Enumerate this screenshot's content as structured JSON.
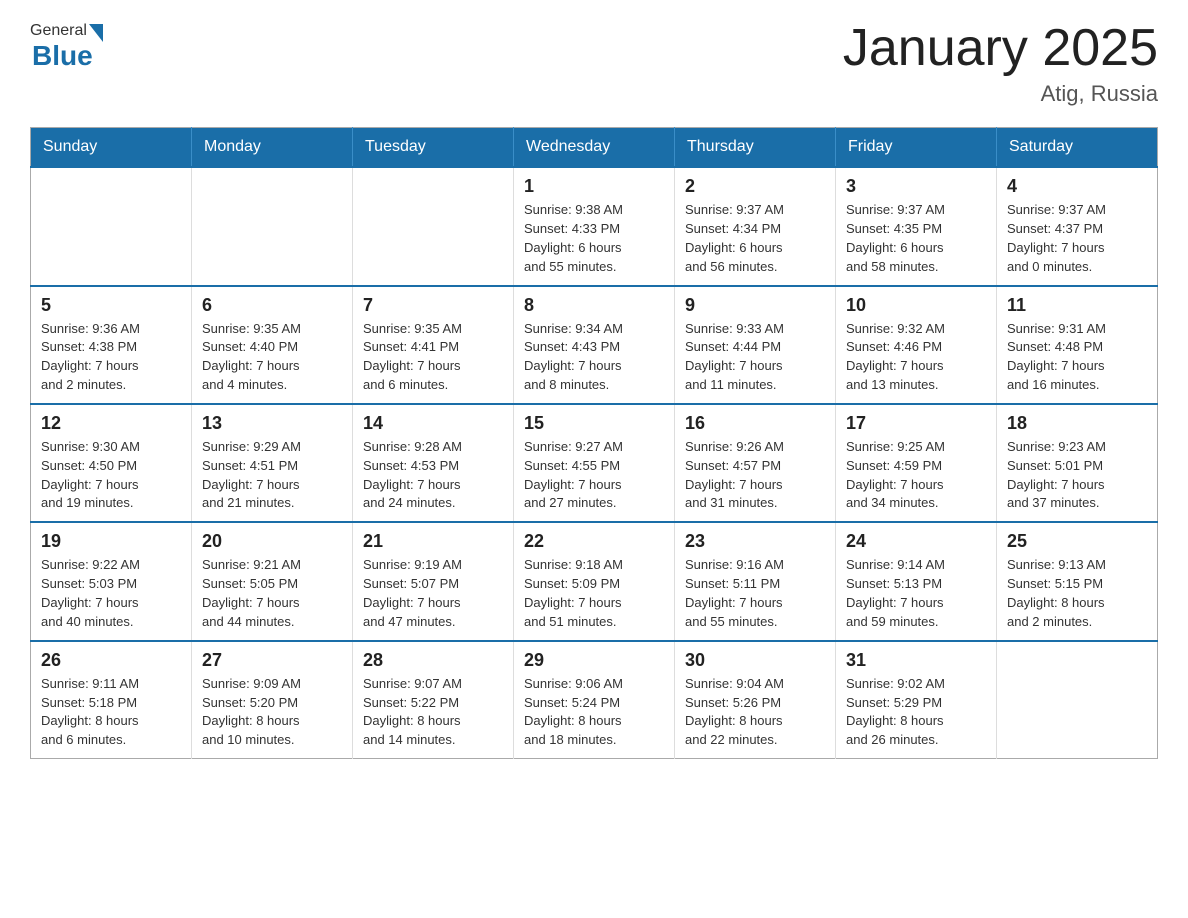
{
  "header": {
    "logo": {
      "part1": "General",
      "part2": "Blue"
    },
    "title": "January 2025",
    "subtitle": "Atig, Russia"
  },
  "weekdays": [
    "Sunday",
    "Monday",
    "Tuesday",
    "Wednesday",
    "Thursday",
    "Friday",
    "Saturday"
  ],
  "weeks": [
    [
      {
        "day": "",
        "info": ""
      },
      {
        "day": "",
        "info": ""
      },
      {
        "day": "",
        "info": ""
      },
      {
        "day": "1",
        "info": "Sunrise: 9:38 AM\nSunset: 4:33 PM\nDaylight: 6 hours\nand 55 minutes."
      },
      {
        "day": "2",
        "info": "Sunrise: 9:37 AM\nSunset: 4:34 PM\nDaylight: 6 hours\nand 56 minutes."
      },
      {
        "day": "3",
        "info": "Sunrise: 9:37 AM\nSunset: 4:35 PM\nDaylight: 6 hours\nand 58 minutes."
      },
      {
        "day": "4",
        "info": "Sunrise: 9:37 AM\nSunset: 4:37 PM\nDaylight: 7 hours\nand 0 minutes."
      }
    ],
    [
      {
        "day": "5",
        "info": "Sunrise: 9:36 AM\nSunset: 4:38 PM\nDaylight: 7 hours\nand 2 minutes."
      },
      {
        "day": "6",
        "info": "Sunrise: 9:35 AM\nSunset: 4:40 PM\nDaylight: 7 hours\nand 4 minutes."
      },
      {
        "day": "7",
        "info": "Sunrise: 9:35 AM\nSunset: 4:41 PM\nDaylight: 7 hours\nand 6 minutes."
      },
      {
        "day": "8",
        "info": "Sunrise: 9:34 AM\nSunset: 4:43 PM\nDaylight: 7 hours\nand 8 minutes."
      },
      {
        "day": "9",
        "info": "Sunrise: 9:33 AM\nSunset: 4:44 PM\nDaylight: 7 hours\nand 11 minutes."
      },
      {
        "day": "10",
        "info": "Sunrise: 9:32 AM\nSunset: 4:46 PM\nDaylight: 7 hours\nand 13 minutes."
      },
      {
        "day": "11",
        "info": "Sunrise: 9:31 AM\nSunset: 4:48 PM\nDaylight: 7 hours\nand 16 minutes."
      }
    ],
    [
      {
        "day": "12",
        "info": "Sunrise: 9:30 AM\nSunset: 4:50 PM\nDaylight: 7 hours\nand 19 minutes."
      },
      {
        "day": "13",
        "info": "Sunrise: 9:29 AM\nSunset: 4:51 PM\nDaylight: 7 hours\nand 21 minutes."
      },
      {
        "day": "14",
        "info": "Sunrise: 9:28 AM\nSunset: 4:53 PM\nDaylight: 7 hours\nand 24 minutes."
      },
      {
        "day": "15",
        "info": "Sunrise: 9:27 AM\nSunset: 4:55 PM\nDaylight: 7 hours\nand 27 minutes."
      },
      {
        "day": "16",
        "info": "Sunrise: 9:26 AM\nSunset: 4:57 PM\nDaylight: 7 hours\nand 31 minutes."
      },
      {
        "day": "17",
        "info": "Sunrise: 9:25 AM\nSunset: 4:59 PM\nDaylight: 7 hours\nand 34 minutes."
      },
      {
        "day": "18",
        "info": "Sunrise: 9:23 AM\nSunset: 5:01 PM\nDaylight: 7 hours\nand 37 minutes."
      }
    ],
    [
      {
        "day": "19",
        "info": "Sunrise: 9:22 AM\nSunset: 5:03 PM\nDaylight: 7 hours\nand 40 minutes."
      },
      {
        "day": "20",
        "info": "Sunrise: 9:21 AM\nSunset: 5:05 PM\nDaylight: 7 hours\nand 44 minutes."
      },
      {
        "day": "21",
        "info": "Sunrise: 9:19 AM\nSunset: 5:07 PM\nDaylight: 7 hours\nand 47 minutes."
      },
      {
        "day": "22",
        "info": "Sunrise: 9:18 AM\nSunset: 5:09 PM\nDaylight: 7 hours\nand 51 minutes."
      },
      {
        "day": "23",
        "info": "Sunrise: 9:16 AM\nSunset: 5:11 PM\nDaylight: 7 hours\nand 55 minutes."
      },
      {
        "day": "24",
        "info": "Sunrise: 9:14 AM\nSunset: 5:13 PM\nDaylight: 7 hours\nand 59 minutes."
      },
      {
        "day": "25",
        "info": "Sunrise: 9:13 AM\nSunset: 5:15 PM\nDaylight: 8 hours\nand 2 minutes."
      }
    ],
    [
      {
        "day": "26",
        "info": "Sunrise: 9:11 AM\nSunset: 5:18 PM\nDaylight: 8 hours\nand 6 minutes."
      },
      {
        "day": "27",
        "info": "Sunrise: 9:09 AM\nSunset: 5:20 PM\nDaylight: 8 hours\nand 10 minutes."
      },
      {
        "day": "28",
        "info": "Sunrise: 9:07 AM\nSunset: 5:22 PM\nDaylight: 8 hours\nand 14 minutes."
      },
      {
        "day": "29",
        "info": "Sunrise: 9:06 AM\nSunset: 5:24 PM\nDaylight: 8 hours\nand 18 minutes."
      },
      {
        "day": "30",
        "info": "Sunrise: 9:04 AM\nSunset: 5:26 PM\nDaylight: 8 hours\nand 22 minutes."
      },
      {
        "day": "31",
        "info": "Sunrise: 9:02 AM\nSunset: 5:29 PM\nDaylight: 8 hours\nand 26 minutes."
      },
      {
        "day": "",
        "info": ""
      }
    ]
  ]
}
